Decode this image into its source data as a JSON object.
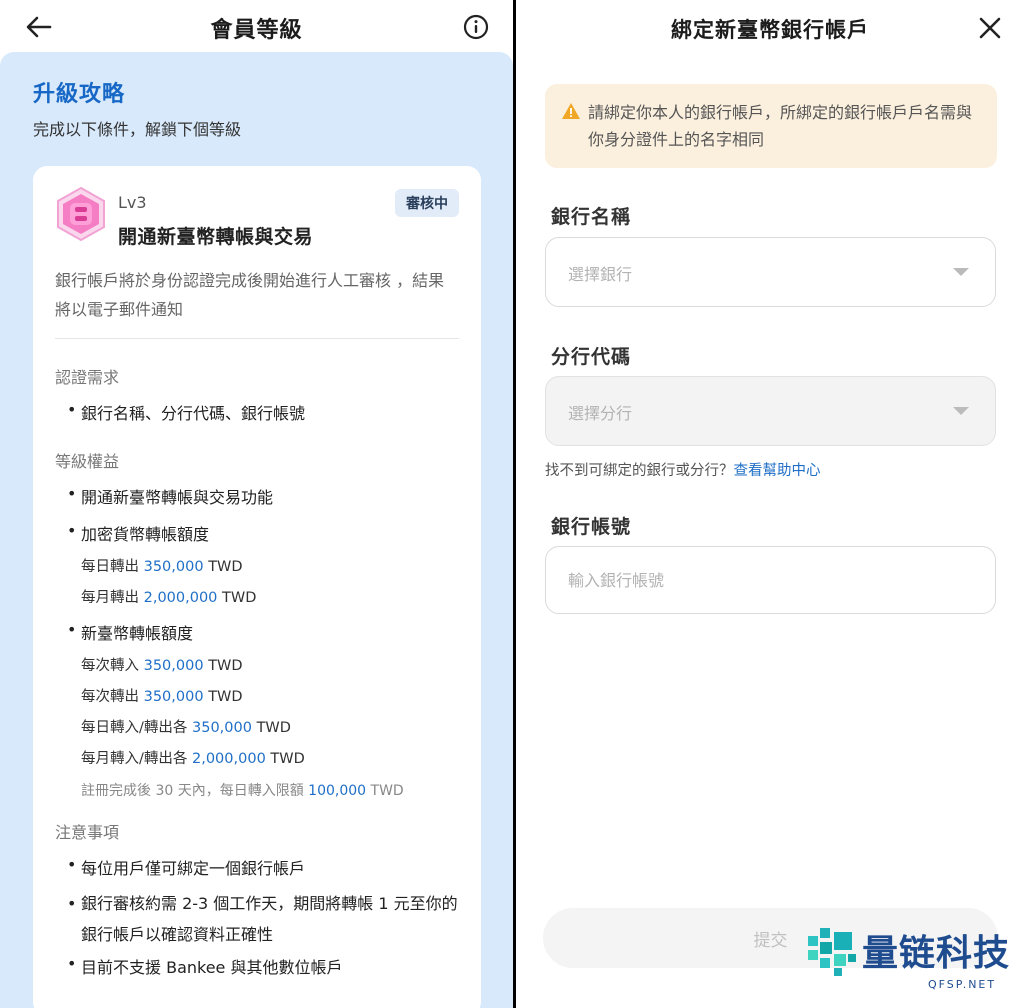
{
  "left": {
    "header": {
      "title": "會員等級"
    },
    "section": {
      "title": "升級攻略",
      "subtitle": "完成以下條件，解鎖下個等級"
    },
    "card": {
      "level": "Lv3",
      "title": "開通新臺幣轉帳與交易",
      "status": "審核中",
      "description": "銀行帳戶將於身份認證完成後開始進行人工審核 ，結果將以電子郵件通知",
      "requirements": {
        "heading": "認證需求",
        "items": [
          "銀行名稱、分行代碼、銀行帳號"
        ]
      },
      "benefits": {
        "heading": "等級權益",
        "item1": "開通新臺幣轉帳與交易功能",
        "item2": "加密貨幣轉帳額度",
        "crypto_daily_label": "每日轉出",
        "crypto_daily_amount": "350,000",
        "crypto_monthly_label": "每月轉出",
        "crypto_monthly_amount": "2,000,000",
        "item3": "新臺幣轉帳額度",
        "twd_in_label": "每次轉入",
        "twd_in_amount": "350,000",
        "twd_out_label": "每次轉出",
        "twd_out_amount": "350,000",
        "twd_daily_label": "每日轉入/轉出各",
        "twd_daily_amount": "350,000",
        "twd_monthly_label": "每月轉入/轉出各",
        "twd_monthly_amount": "2,000,000",
        "note_label": "註冊完成後 30 天內，每日轉入限額",
        "note_amount": "100,000",
        "currency": "TWD"
      },
      "notes": {
        "heading": "注意事項",
        "items": [
          "每位用戶僅可綁定一個銀行帳戶",
          "銀行審核約需 2-3 個工作天，期間將轉帳 1 元至你的銀行帳戶以確認資料正確性",
          "目前不支援 Bankee 與其他數位帳戶"
        ]
      }
    }
  },
  "right": {
    "header": {
      "title": "綁定新臺幣銀行帳戶"
    },
    "warning": "請綁定你本人的銀行帳戶，所綁定的銀行帳戶戶名需與你身分證件上的名字相同",
    "fields": {
      "bank_name": {
        "label": "銀行名稱",
        "placeholder": "選擇銀行"
      },
      "branch_code": {
        "label": "分行代碼",
        "placeholder": "選擇分行"
      },
      "account_no": {
        "label": "銀行帳號",
        "placeholder": "輸入銀行帳號"
      }
    },
    "help": {
      "text": "找不到可綁定的銀行或分行？",
      "link": "查看幫助中心"
    },
    "submit": "提交"
  },
  "watermark": {
    "brand": "量链科技",
    "domain": "QFSP.NET"
  },
  "colors": {
    "accent": "#1768c6",
    "panel_bg": "#d8e9fb",
    "warning_bg": "#fbf0de"
  }
}
